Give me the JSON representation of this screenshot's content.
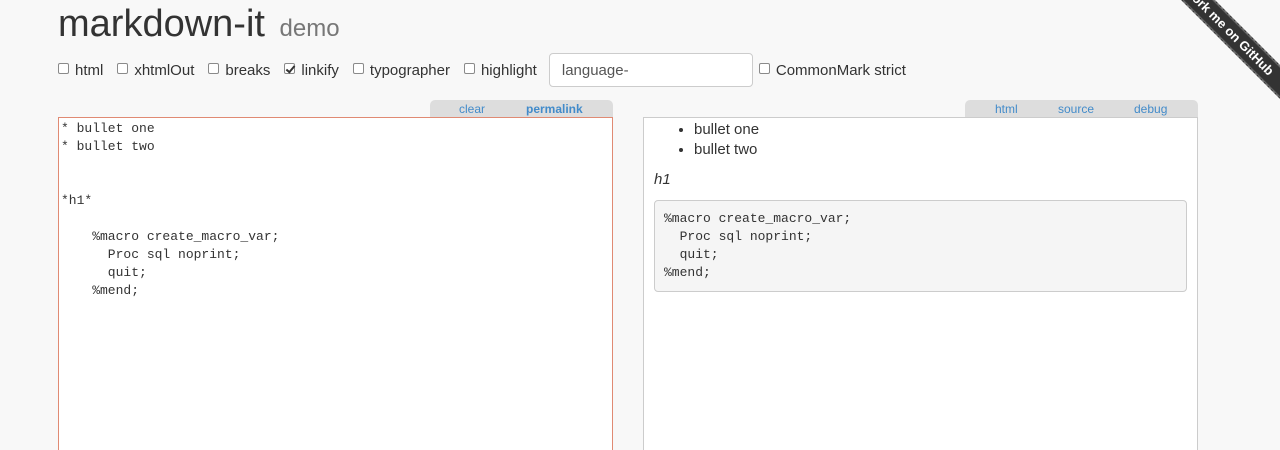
{
  "header": {
    "title": "markdown-it",
    "subtitle": "demo"
  },
  "options": {
    "html": {
      "label": "html",
      "checked": false
    },
    "xhtmlOut": {
      "label": "xhtmlOut",
      "checked": false
    },
    "breaks": {
      "label": "breaks",
      "checked": false
    },
    "linkify": {
      "label": "linkify",
      "checked": true
    },
    "typographer": {
      "label": "typographer",
      "checked": false
    },
    "highlight": {
      "label": "highlight",
      "checked": false
    },
    "lang_prefix": {
      "value": "language-"
    },
    "commonmark": {
      "label": "CommonMark strict",
      "checked": false
    }
  },
  "source_tabs": {
    "clear": "clear",
    "permalink": "permalink"
  },
  "result_tabs": {
    "html": "html",
    "source": "source",
    "debug": "debug"
  },
  "source": {
    "text": "* bullet one\n* bullet two\n\n\n*h1*\n\n    %macro create_macro_var;\n      Proc sql noprint;\n      quit;\n    %mend;"
  },
  "result": {
    "list": [
      "bullet one",
      "bullet two"
    ],
    "emphasis": "h1",
    "code": "%macro create_macro_var;\n  Proc sql noprint;\n  quit;\n%mend;"
  },
  "ribbon": {
    "label": "Fork me on GitHub"
  }
}
